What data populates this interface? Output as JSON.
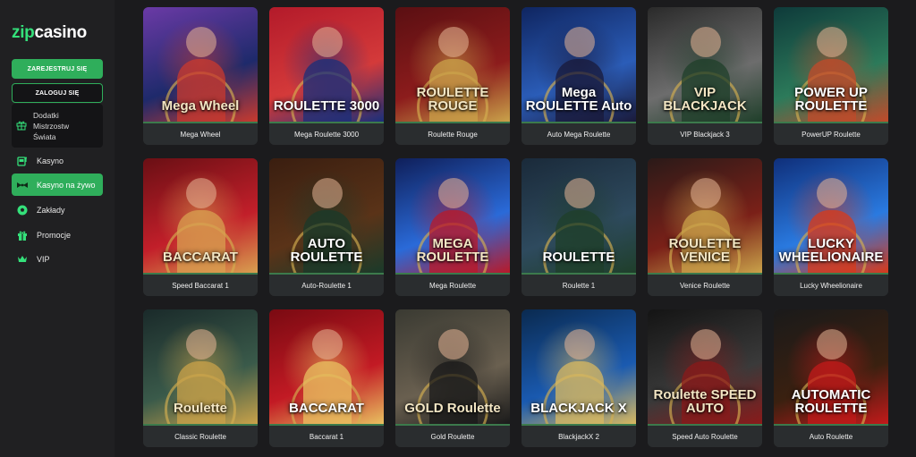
{
  "brand": {
    "logo_prefix": "zip",
    "logo_suffix": "casino"
  },
  "auth": {
    "register_label": "ZAREJESTRUJ SIĘ",
    "login_label": "ZALOGUJ SIĘ"
  },
  "promo": {
    "line1": "Dodatki",
    "line2": "Mistrzostw",
    "line3": "Świata",
    "icon": "gift-icon"
  },
  "nav": [
    {
      "label": "Kasyno",
      "icon": "slot-machine-icon",
      "active": false
    },
    {
      "label": "Kasyno na żywo",
      "icon": "bowtie-icon",
      "active": true
    },
    {
      "label": "Zakłady",
      "icon": "soccer-ball-icon",
      "active": false
    },
    {
      "label": "Promocje",
      "icon": "gift-icon",
      "active": false
    },
    {
      "label": "VIP",
      "icon": "crown-icon",
      "active": false
    }
  ],
  "colors": {
    "accent": "#2fae5b",
    "sidebar_bg": "#202022",
    "card_bg": "#2a2d2f",
    "page_bg": "#1b1b1d"
  },
  "games": [
    {
      "title": "Mega Wheel",
      "art": "Mega Wheel"
    },
    {
      "title": "Mega Roulette 3000",
      "art": "ROULETTE 3000"
    },
    {
      "title": "Roulette Rouge",
      "art": "ROULETTE ROUGE"
    },
    {
      "title": "Auto Mega Roulette",
      "art": "Mega ROULETTE Auto"
    },
    {
      "title": "VIP Blackjack 3",
      "art": "VIP BLACKJACK"
    },
    {
      "title": "PowerUP Roulette",
      "art": "POWER UP ROULETTE"
    },
    {
      "title": "Speed Baccarat 1",
      "art": "BACCARAT"
    },
    {
      "title": "Auto-Roulette 1",
      "art": "AUTO ROULETTE"
    },
    {
      "title": "Mega Roulette",
      "art": "MEGA ROULETTE"
    },
    {
      "title": "Roulette 1",
      "art": "ROULETTE"
    },
    {
      "title": "Venice Roulette",
      "art": "ROULETTE VENICE"
    },
    {
      "title": "Lucky Wheelionaire",
      "art": "LUCKY WHEELIONAIRE"
    },
    {
      "title": "Classic Roulette",
      "art": "Roulette"
    },
    {
      "title": "Baccarat 1",
      "art": "BACCARAT"
    },
    {
      "title": "Gold Roulette",
      "art": "GOLD Roulette"
    },
    {
      "title": "BlackjackX 2",
      "art": "BLACKJACK X"
    },
    {
      "title": "Speed Auto Roulette",
      "art": "Roulette SPEED AUTO"
    },
    {
      "title": "Auto Roulette",
      "art": "AUTOMATIC ROULETTE"
    }
  ]
}
